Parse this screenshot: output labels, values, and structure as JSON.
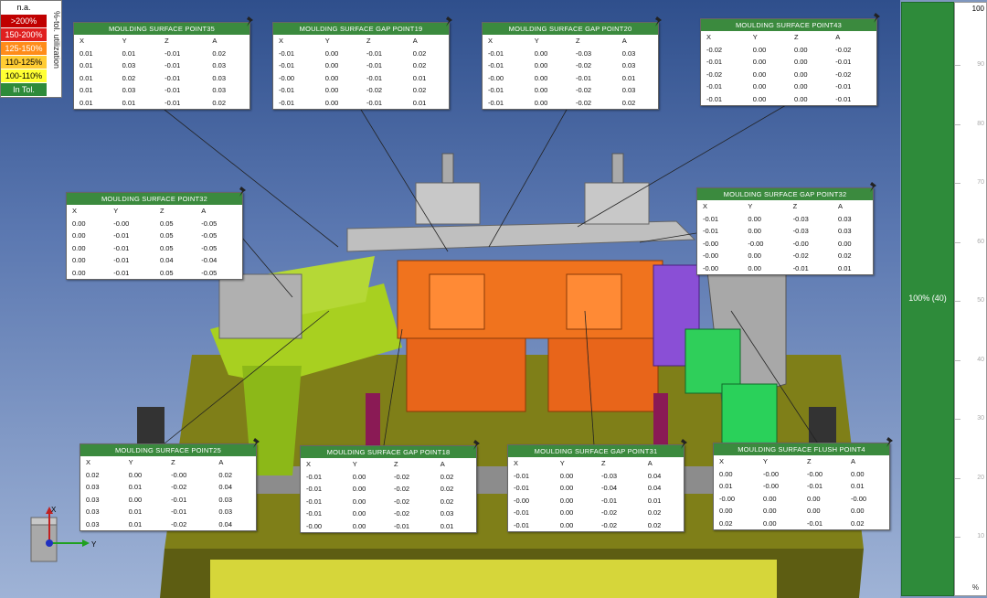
{
  "legend": {
    "title": "%-tol. utilization",
    "rows": [
      {
        "label": "n.a.",
        "color": "#ffffff",
        "text": "#000000"
      },
      {
        "label": ">200%",
        "color": "#c00000",
        "text": "#ffffff"
      },
      {
        "label": "150-200%",
        "color": "#e02020",
        "text": "#ffffff"
      },
      {
        "label": "125-150%",
        "color": "#ff8c1a",
        "text": "#ffffff"
      },
      {
        "label": "110-125%",
        "color": "#ffcc33",
        "text": "#000000"
      },
      {
        "label": "100-110%",
        "color": "#ffff33",
        "text": "#000000"
      },
      {
        "label": "In Tol.",
        "color": "#2e8b3a",
        "text": "#ffffff"
      }
    ]
  },
  "headers": [
    "X",
    "Y",
    "Z",
    "A"
  ],
  "panels": [
    {
      "title": "MOULDING SURFACE POINT35",
      "rows": [
        [
          "0.01",
          "0.01",
          "-0.01",
          "0.02"
        ],
        [
          "0.01",
          "0.03",
          "-0.01",
          "0.03"
        ],
        [
          "0.01",
          "0.02",
          "-0.01",
          "0.03"
        ],
        [
          "0.01",
          "0.03",
          "-0.01",
          "0.03"
        ],
        [
          "0.01",
          "0.01",
          "-0.01",
          "0.02"
        ]
      ]
    },
    {
      "title": "MOULDING SURFACE GAP POINT19",
      "rows": [
        [
          "-0.01",
          "0.00",
          "-0.01",
          "0.02"
        ],
        [
          "-0.01",
          "0.00",
          "-0.01",
          "0.02"
        ],
        [
          "-0.00",
          "0.00",
          "-0.01",
          "0.01"
        ],
        [
          "-0.01",
          "0.00",
          "-0.02",
          "0.02"
        ],
        [
          "-0.01",
          "0.00",
          "-0.01",
          "0.01"
        ]
      ]
    },
    {
      "title": "MOULDING SURFACE GAP POINT20",
      "rows": [
        [
          "-0.01",
          "0.00",
          "-0.03",
          "0.03"
        ],
        [
          "-0.01",
          "0.00",
          "-0.02",
          "0.03"
        ],
        [
          "-0.00",
          "0.00",
          "-0.01",
          "0.01"
        ],
        [
          "-0.01",
          "0.00",
          "-0.02",
          "0.03"
        ],
        [
          "-0.01",
          "0.00",
          "-0.02",
          "0.02"
        ]
      ]
    },
    {
      "title": "MOULDING SURFACE POINT43",
      "rows": [
        [
          "-0.02",
          "0.00",
          "0.00",
          "-0.02"
        ],
        [
          "-0.01",
          "0.00",
          "0.00",
          "-0.01"
        ],
        [
          "-0.02",
          "0.00",
          "0.00",
          "-0.02"
        ],
        [
          "-0.01",
          "0.00",
          "0.00",
          "-0.01"
        ],
        [
          "-0.01",
          "0.00",
          "0.00",
          "-0.01"
        ]
      ]
    },
    {
      "title": "MOULDING SURFACE POINT32",
      "rows": [
        [
          "0.00",
          "-0.00",
          "0.05",
          "-0.05"
        ],
        [
          "0.00",
          "-0.01",
          "0.05",
          "-0.05"
        ],
        [
          "0.00",
          "-0.01",
          "0.05",
          "-0.05"
        ],
        [
          "0.00",
          "-0.01",
          "0.04",
          "-0.04"
        ],
        [
          "0.00",
          "-0.01",
          "0.05",
          "-0.05"
        ]
      ]
    },
    {
      "title": "MOULDING SURFACE GAP POINT32",
      "rows": [
        [
          "-0.01",
          "0.00",
          "-0.03",
          "0.03"
        ],
        [
          "-0.01",
          "0.00",
          "-0.03",
          "0.03"
        ],
        [
          "-0.00",
          "-0.00",
          "-0.00",
          "0.00"
        ],
        [
          "-0.00",
          "0.00",
          "-0.02",
          "0.02"
        ],
        [
          "-0.00",
          "0.00",
          "-0.01",
          "0.01"
        ]
      ]
    },
    {
      "title": "MOULDING SURFACE POINT25",
      "rows": [
        [
          "0.02",
          "0.00",
          "-0.00",
          "0.02"
        ],
        [
          "0.03",
          "0.01",
          "-0.02",
          "0.04"
        ],
        [
          "0.03",
          "0.00",
          "-0.01",
          "0.03"
        ],
        [
          "0.03",
          "0.01",
          "-0.01",
          "0.03"
        ],
        [
          "0.03",
          "0.01",
          "-0.02",
          "0.04"
        ]
      ]
    },
    {
      "title": "MOULDING SURFACE GAP POINT18",
      "rows": [
        [
          "-0.01",
          "0.00",
          "-0.02",
          "0.02"
        ],
        [
          "-0.01",
          "0.00",
          "-0.02",
          "0.02"
        ],
        [
          "-0.01",
          "0.00",
          "-0.02",
          "0.02"
        ],
        [
          "-0.01",
          "0.00",
          "-0.02",
          "0.03"
        ],
        [
          "-0.00",
          "0.00",
          "-0.01",
          "0.01"
        ]
      ]
    },
    {
      "title": "MOULDING SURFACE GAP POINT31",
      "rows": [
        [
          "-0.01",
          "0.00",
          "-0.03",
          "0.04"
        ],
        [
          "-0.01",
          "0.00",
          "-0.04",
          "0.04"
        ],
        [
          "-0.00",
          "0.00",
          "-0.01",
          "0.01"
        ],
        [
          "-0.01",
          "0.00",
          "-0.02",
          "0.02"
        ],
        [
          "-0.01",
          "0.00",
          "-0.02",
          "0.02"
        ]
      ]
    },
    {
      "title": "MOULDING SURFACE FLUSH POINT4",
      "rows": [
        [
          "0.00",
          "-0.00",
          "-0.00",
          "0.00"
        ],
        [
          "0.01",
          "-0.00",
          "-0.01",
          "0.01"
        ],
        [
          "-0.00",
          "0.00",
          "0.00",
          "-0.00"
        ],
        [
          "0.00",
          "0.00",
          "0.00",
          "0.00"
        ],
        [
          "0.02",
          "0.00",
          "-0.01",
          "0.02"
        ]
      ]
    }
  ],
  "sidebar": {
    "label": "100% (40)",
    "color": "#2e8b3a"
  },
  "scale": {
    "top": "100",
    "ticks": [
      "90",
      "80",
      "70",
      "60",
      "50",
      "40",
      "30",
      "20",
      "10"
    ],
    "percent_symbol": "%"
  },
  "triad": {
    "x_label": "X",
    "y_label": "Y"
  }
}
